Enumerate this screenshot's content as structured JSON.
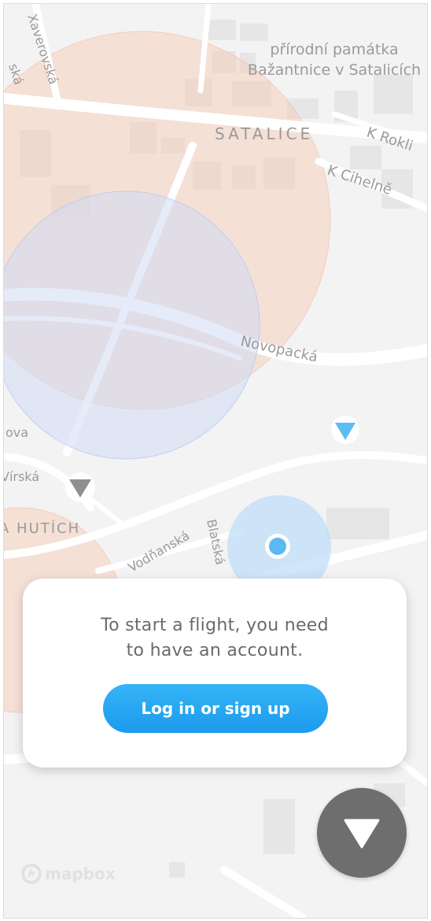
{
  "map": {
    "labels": {
      "poi_line1": "přírodní památka",
      "poi_line2": "Bažantnice v Satalicích",
      "district_satalice": "SATALICE",
      "street_k_rokli": "K Rokli",
      "street_k_cihelne": "K Cihelně",
      "street_xaverovska": "Xaverovská",
      "street_ska": "ská",
      "street_novopacka": "Novopacká",
      "street_ova": "ova",
      "street_virska": "Vírská",
      "district_hutich": "A HUTÍCH",
      "street_vodnanska": "Vodňanská",
      "street_blatska": "Blatská"
    },
    "colors": {
      "restricted_zone": "#f9c9b4",
      "caution_zone": "#cfdaf4",
      "user_accuracy": "#bcdcf8",
      "user_dot": "#5cb9f3",
      "drone_active": "#5cbcf4",
      "drone_inactive": "#8f8f8f"
    }
  },
  "prompt": {
    "message_line1": "To start a flight, you need",
    "message_line2": "to have an account.",
    "button_label": "Log in or sign up"
  },
  "logo": {
    "text": "mapbox"
  },
  "theme": {
    "fab_color": "#6e6e6e",
    "accent": "#1c9aee"
  }
}
